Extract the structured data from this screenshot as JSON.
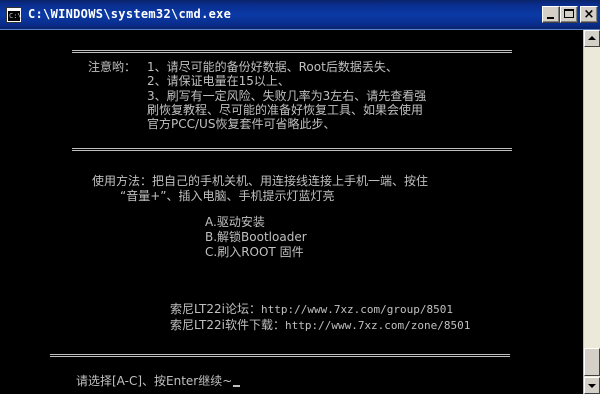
{
  "window": {
    "title": "C:\\WINDOWS\\system32\\cmd.exe",
    "icon_label": "C:\\",
    "minimize_icon": "minimize-icon",
    "maximize_icon": "maximize-icon",
    "close_glyph": "×"
  },
  "console": {
    "notice_label": "注意哟：",
    "notice_items": [
      "1、请尽可能的备份好数据、Root后数据丢失、",
      "2、请保证电量在15以上、",
      "3、刷写有一定风险、失败几率为3左右、请先查看强",
      "刷恢复教程、尽可能的准备好恢复工具、如果会使用",
      "官方PCC/US恢复套件可省略此步、"
    ],
    "usage_lines": [
      "使用方法：把自己的手机关机、用连接线连接上手机一端、按住",
      "“音量+”、插入电脑、手机提示灯蓝灯亮"
    ],
    "options": [
      "A.驱动安装",
      "B.解锁Bootloader",
      "C.刷入ROOT 固件"
    ],
    "links": [
      {
        "label": "索尼LT22i论坛：",
        "url": "http://www.7xz.com/group/8501"
      },
      {
        "label": "索尼LT22i软件下载：",
        "url": "http://www.7xz.com/zone/8501"
      }
    ],
    "prompt": "请选择[A-C]、按Enter继续~"
  },
  "colors": {
    "console_bg": "#000000",
    "console_fg": "#c0c0c0",
    "titlebar": "#0a2d8c"
  }
}
